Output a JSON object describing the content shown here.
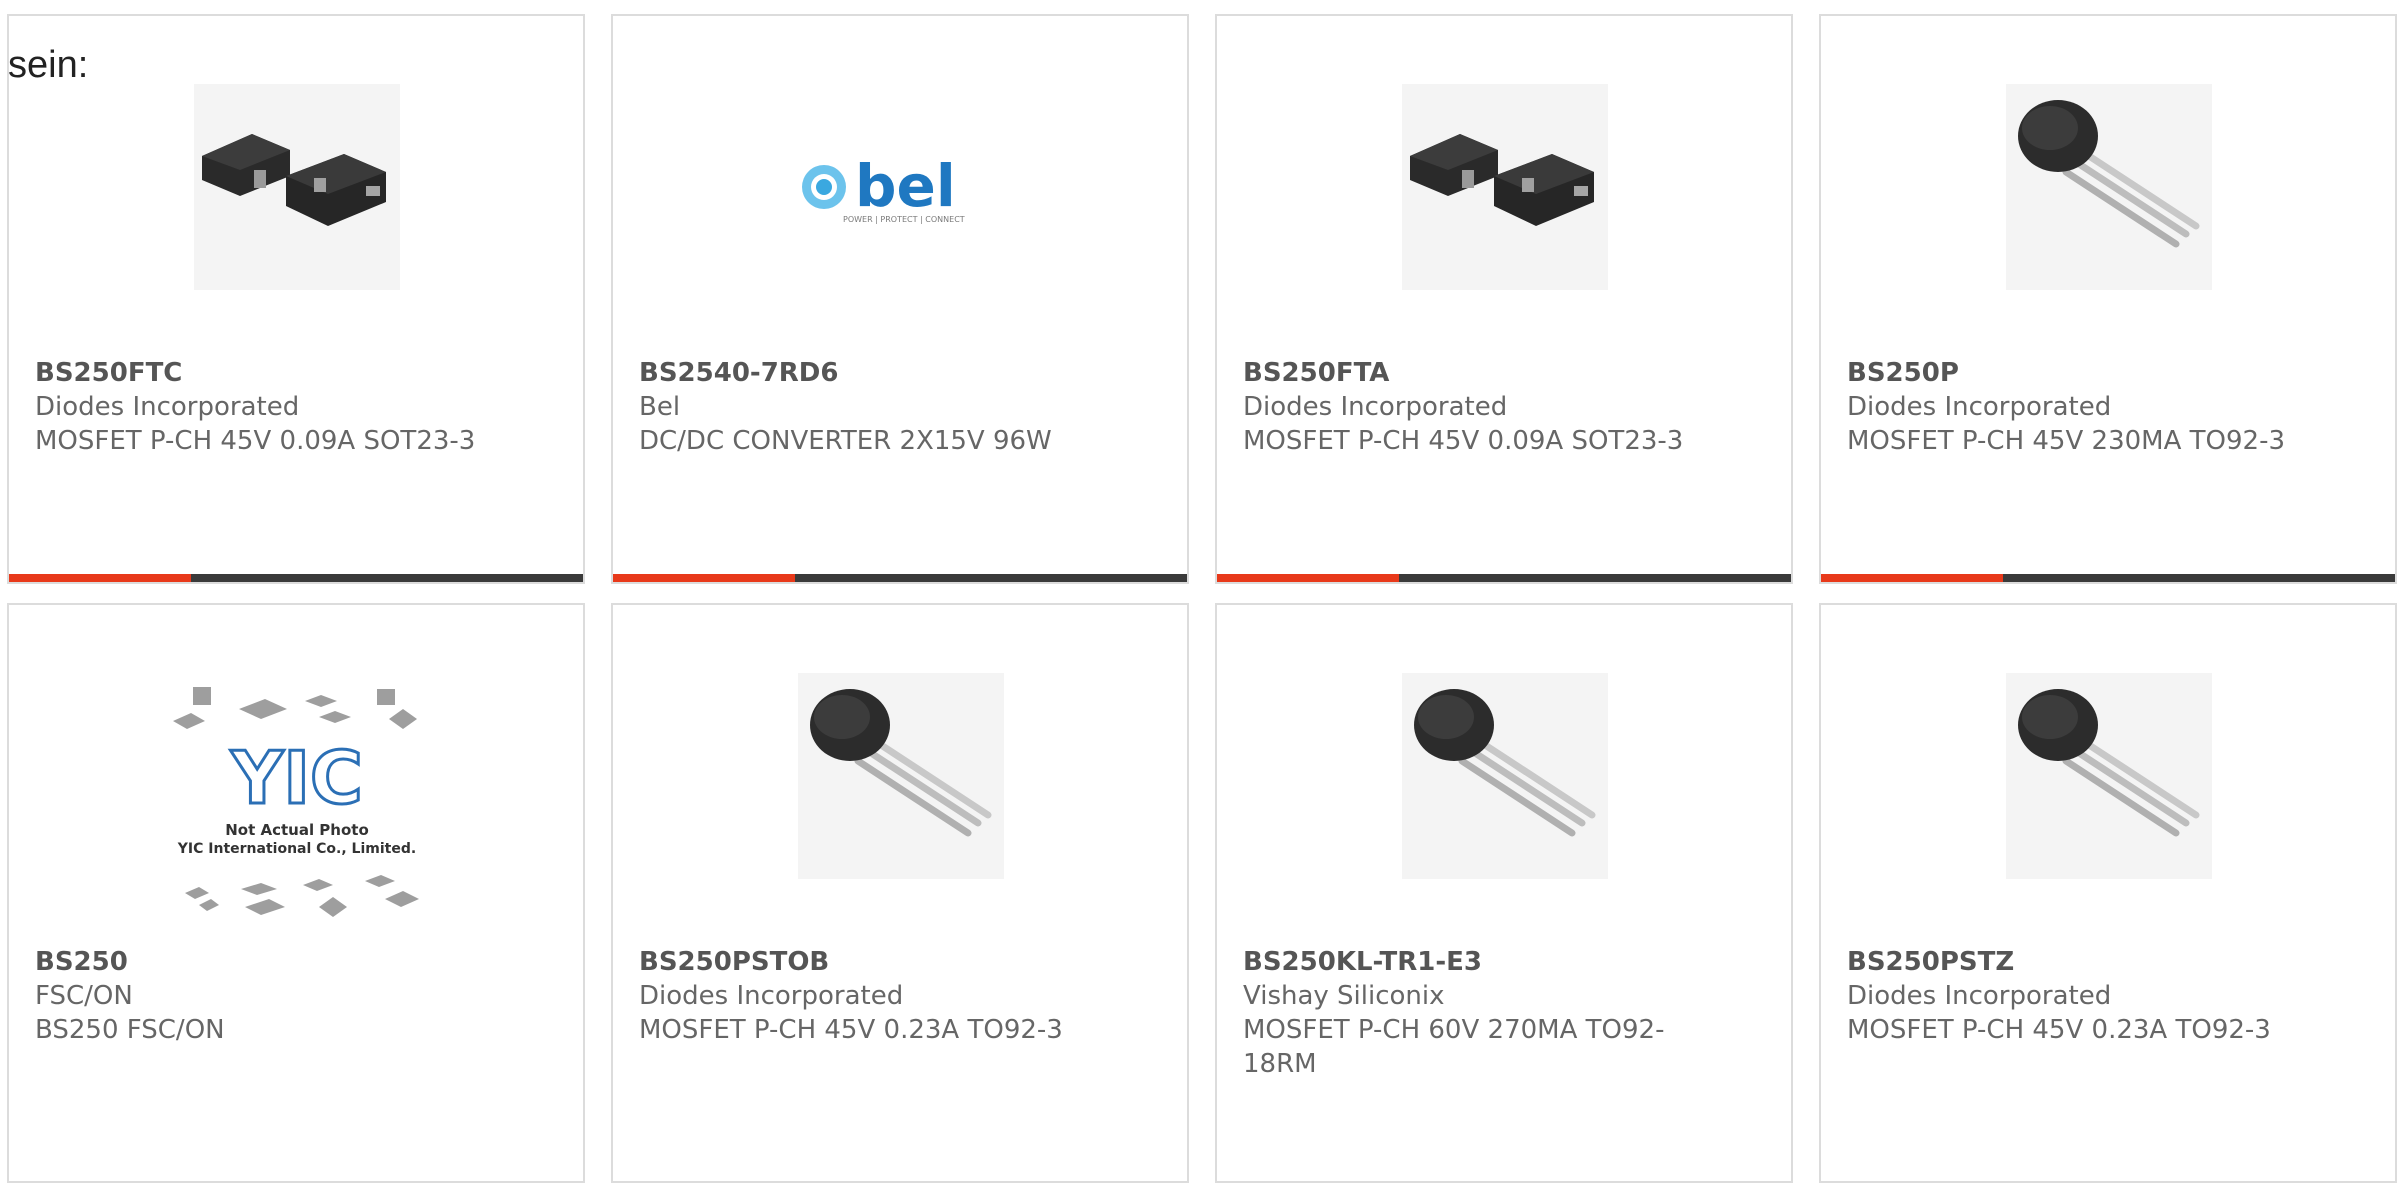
{
  "intro_text": "sein:",
  "accent_color": "#e8391a",
  "bar_color": "#3a3a3a",
  "cards": [
    {
      "part": "BS250FTC",
      "mfr": "Diodes Incorporated",
      "desc": "MOSFET P-CH 45V 0.09A SOT23-3",
      "image": "sot23-package-icon"
    },
    {
      "part": "BS2540-7RD6",
      "mfr": "Bel",
      "desc": "DC/DC CONVERTER 2X15V 96W",
      "image": "bel-logo"
    },
    {
      "part": "BS250FTA",
      "mfr": "Diodes Incorporated",
      "desc": "MOSFET P-CH 45V 0.09A SOT23-3",
      "image": "sot23-package-icon"
    },
    {
      "part": "BS250P",
      "mfr": "Diodes Incorporated",
      "desc": "MOSFET P-CH 45V 230MA TO92-3",
      "image": "to92-package-icon"
    },
    {
      "part": "BS250",
      "mfr": "FSC/ON",
      "desc": "BS250 FSC/ON",
      "image": "yic-placeholder"
    },
    {
      "part": "BS250PSTOB",
      "mfr": "Diodes Incorporated",
      "desc": "MOSFET P-CH 45V 0.23A TO92-3",
      "image": "to92-package-icon"
    },
    {
      "part": "BS250KL-TR1-E3",
      "mfr": "Vishay Siliconix",
      "desc": "MOSFET P-CH 60V 270MA TO92-18RM",
      "image": "to92-package-icon"
    },
    {
      "part": "BS250PSTZ",
      "mfr": "Diodes Incorporated",
      "desc": "MOSFET P-CH 45V 0.23A TO92-3",
      "image": "to92-package-icon"
    }
  ],
  "logo": {
    "bel_text": "bel",
    "bel_tagline": "POWER | PROTECT | CONNECT",
    "yic_text": "YIC",
    "yic_caption_1": "Not Actual Photo",
    "yic_caption_2": "YIC International Co., Limited."
  }
}
